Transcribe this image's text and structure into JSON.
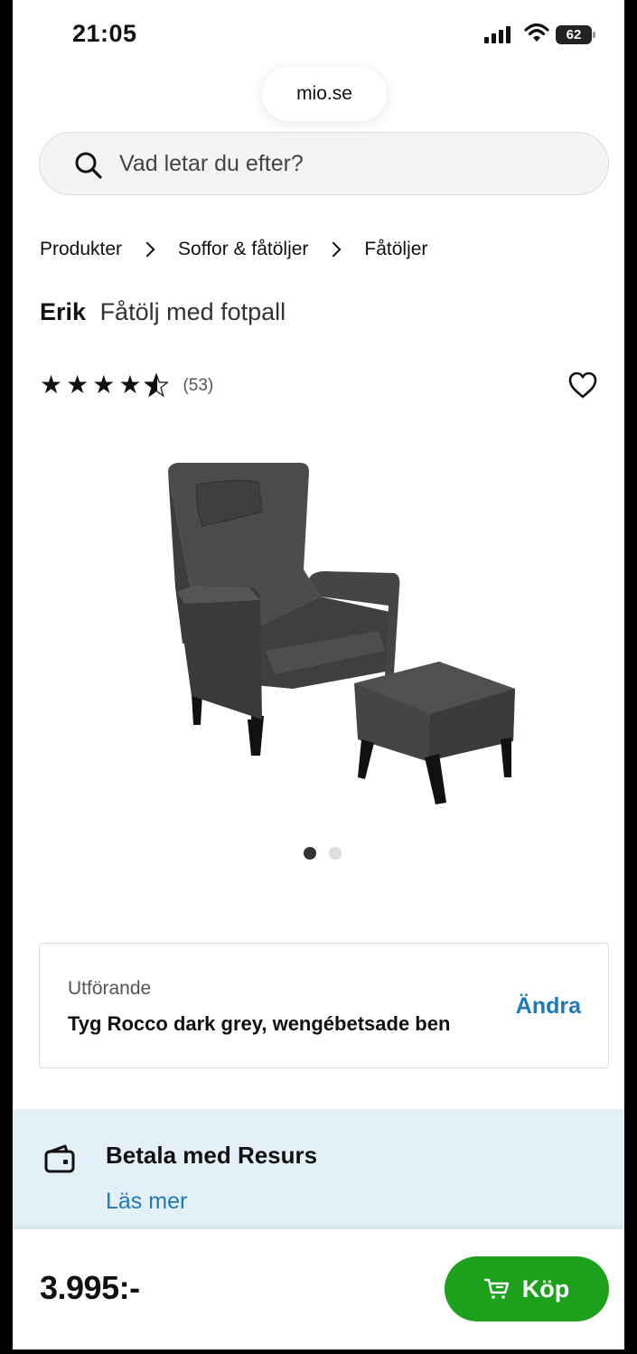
{
  "status_bar": {
    "time": "21:05",
    "battery": "62"
  },
  "browser": {
    "url": "mio.se"
  },
  "search": {
    "placeholder": "Vad letar du efter?"
  },
  "breadcrumb": [
    "Produkter",
    "Soffor & fåtöljer",
    "Fåtöljer"
  ],
  "product": {
    "brand": "Erik",
    "subtitle": "Fåtölj med fotpall",
    "rating": 4.5,
    "rating_count": "(53)",
    "image_count": 2,
    "active_image": 1
  },
  "variant": {
    "label": "Utförande",
    "value": "Tyg Rocco dark grey, wengébetsade ben",
    "change_label": "Ändra"
  },
  "payment": {
    "title": "Betala med Resurs",
    "link": "Läs mer"
  },
  "purchase": {
    "price": "3.995:-",
    "buy_label": "Köp"
  },
  "colors": {
    "accent_blue": "#1e7ab5",
    "buy_green": "#1da11d",
    "pay_bg": "#e3f0f7"
  }
}
